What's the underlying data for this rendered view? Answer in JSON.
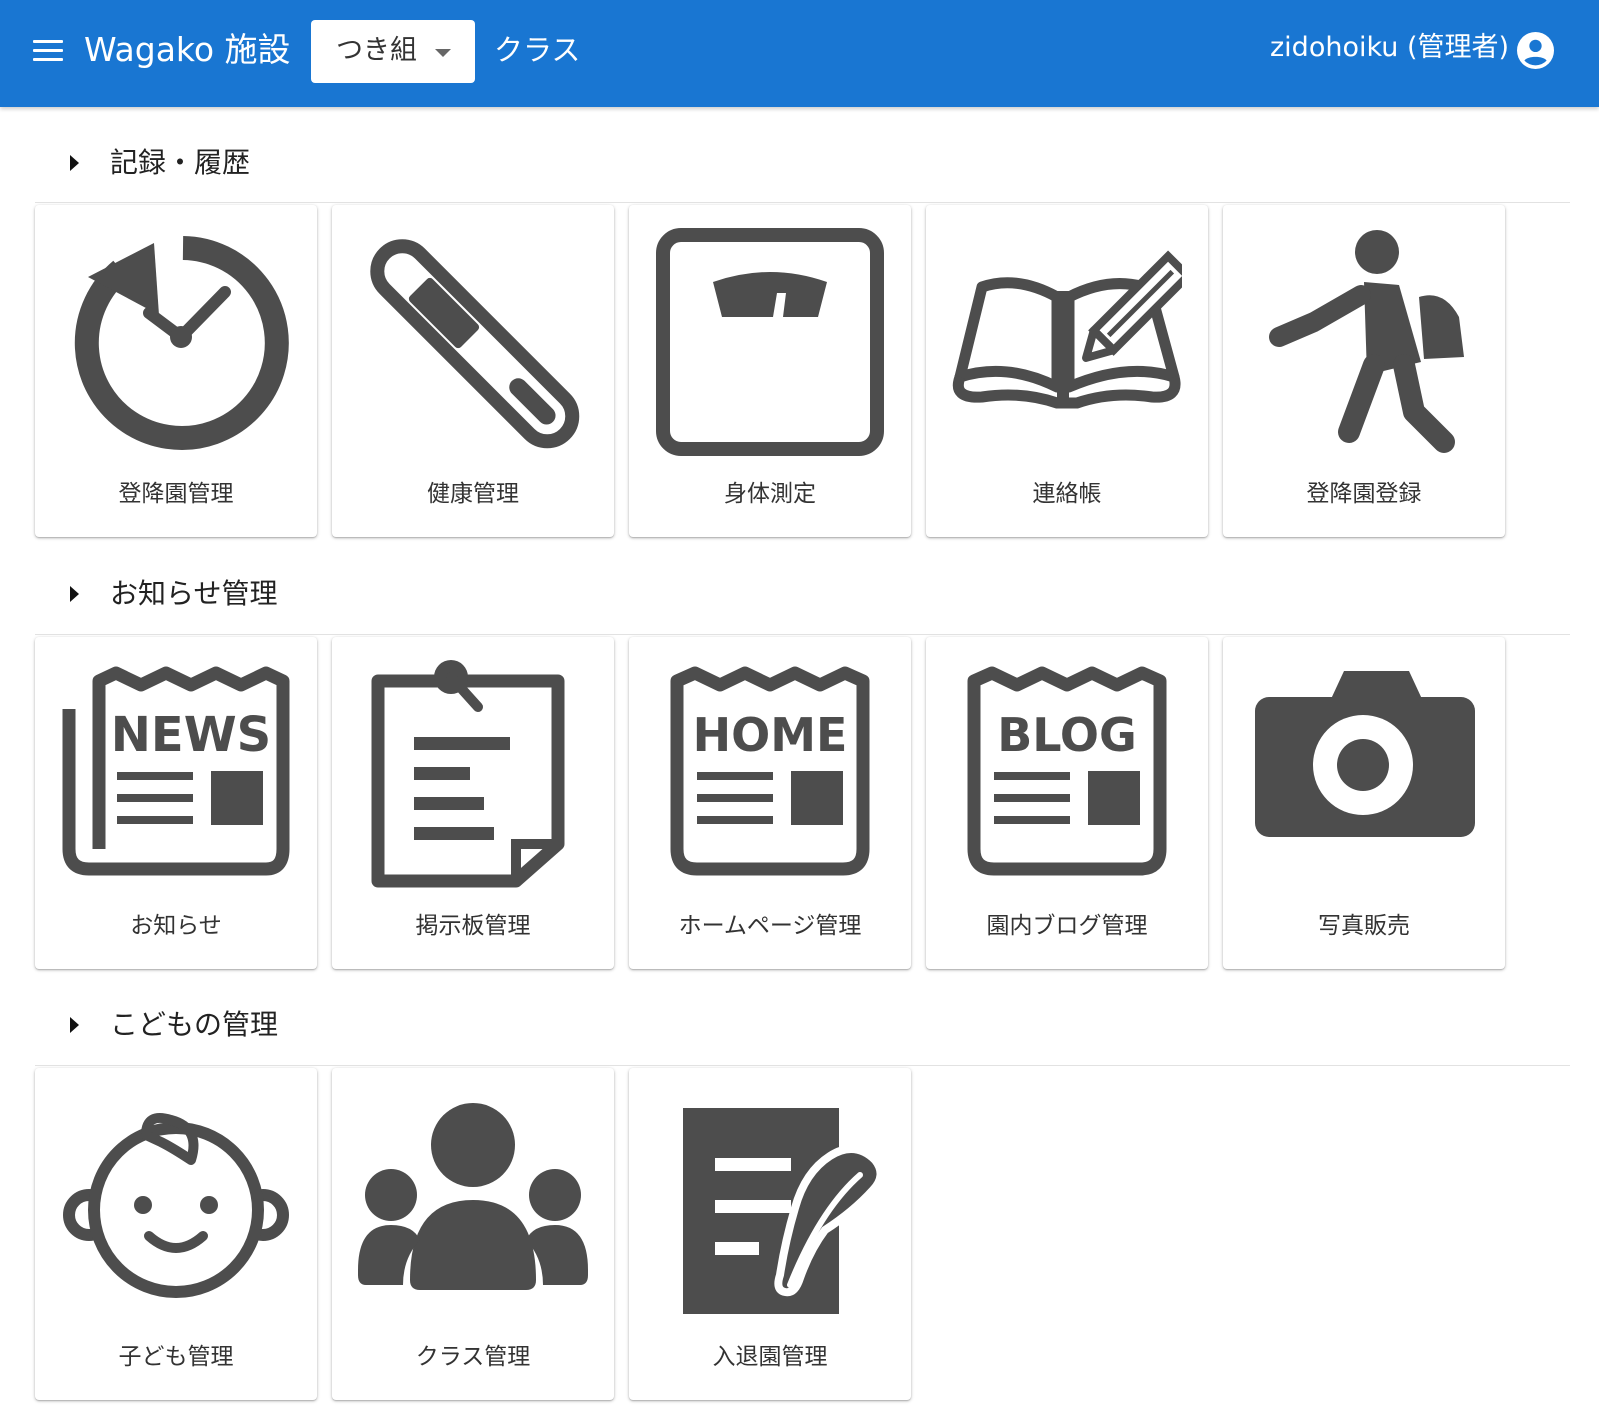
{
  "header": {
    "app_title": "Wagako 施設",
    "class_selector": {
      "value": "つき組"
    },
    "class_link": "クラス",
    "user": "zidohoiku (管理者)"
  },
  "colors": {
    "appbar": "#1976d2",
    "icon": "#4d4d4d"
  },
  "sections": [
    {
      "title": "記録・履歴",
      "items": [
        {
          "label": "登降園管理",
          "icon": "clock-history-icon"
        },
        {
          "label": "健康管理",
          "icon": "thermometer-icon"
        },
        {
          "label": "身体測定",
          "icon": "weight-scale-icon"
        },
        {
          "label": "連絡帳",
          "icon": "notebook-pencil-icon"
        },
        {
          "label": "登降園登録",
          "icon": "walking-child-icon"
        }
      ]
    },
    {
      "title": "お知らせ管理",
      "items": [
        {
          "label": "お知らせ",
          "icon": "news-icon",
          "icon_text": "NEWS"
        },
        {
          "label": "掲示板管理",
          "icon": "bulletin-board-icon"
        },
        {
          "label": "ホームページ管理",
          "icon": "homepage-icon",
          "icon_text": "HOME"
        },
        {
          "label": "園内ブログ管理",
          "icon": "blog-icon",
          "icon_text": "BLOG"
        },
        {
          "label": "写真販売",
          "icon": "camera-icon"
        }
      ]
    },
    {
      "title": "こどもの管理",
      "items": [
        {
          "label": "子ども管理",
          "icon": "baby-face-icon"
        },
        {
          "label": "クラス管理",
          "icon": "group-icon"
        },
        {
          "label": "入退園管理",
          "icon": "document-quill-icon"
        }
      ]
    }
  ]
}
